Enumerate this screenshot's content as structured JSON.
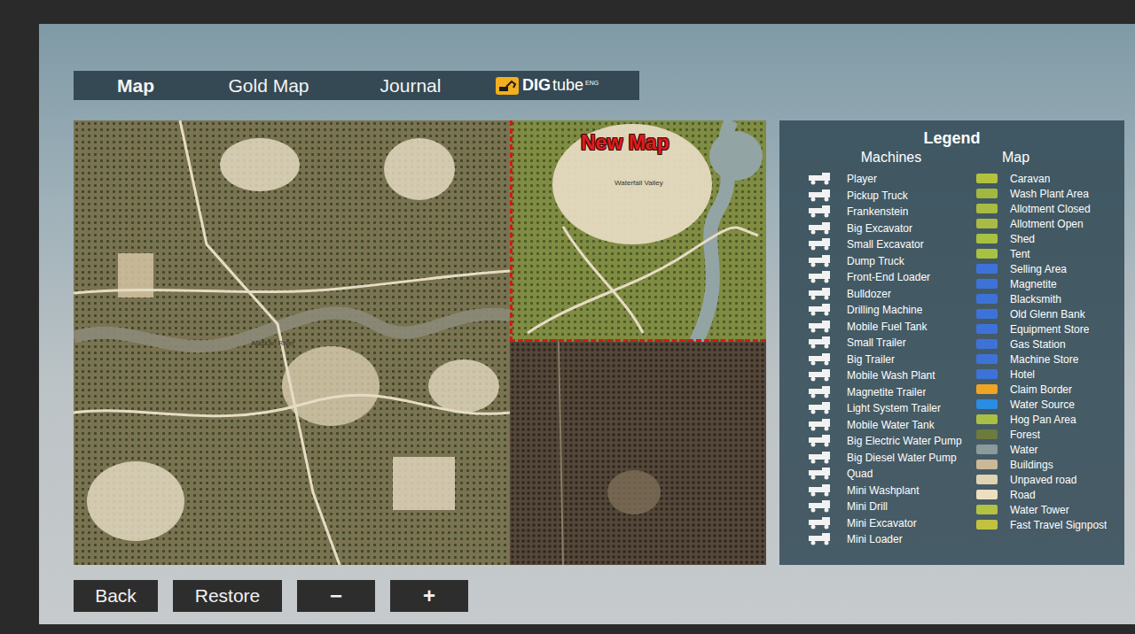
{
  "tabs": [
    {
      "label": "Map",
      "selected": true
    },
    {
      "label": "Gold Map",
      "selected": false
    },
    {
      "label": "Journal",
      "selected": false
    }
  ],
  "brand": {
    "bold": "DIG",
    "light": "tube",
    "superscript": "ENG"
  },
  "map": {
    "new_map_label": "New Map",
    "labels": [
      {
        "text": "Alaskan River",
        "tile": "main"
      },
      {
        "text": "Waterfall Valley",
        "tile": "new"
      }
    ]
  },
  "legend": {
    "title": "Legend",
    "machines": {
      "heading": "Machines",
      "items": [
        "Player",
        "Pickup Truck",
        "Frankenstein",
        "Big Excavator",
        "Small Excavator",
        "Dump Truck",
        "Front-End Loader",
        "Bulldozer",
        "Drilling Machine",
        "Mobile Fuel Tank",
        "Small Trailer",
        "Big Trailer",
        "Mobile Wash Plant",
        "Magnetite Trailer",
        "Light System Trailer",
        "Mobile Water Tank",
        "Big Electric Water Pump",
        "Big Diesel Water Pump",
        "Quad",
        "Mini Washplant",
        "Mini Drill",
        "Mini Excavator",
        "Mini Loader"
      ]
    },
    "map": {
      "heading": "Map",
      "items": [
        {
          "label": "Caravan",
          "color": "#b3c23c"
        },
        {
          "label": "Wash Plant Area",
          "color": "#a3b83e"
        },
        {
          "label": "Allotment Closed",
          "color": "#a9bb42"
        },
        {
          "label": "Allotment Open",
          "color": "#a9bb42"
        },
        {
          "label": "Shed",
          "color": "#a7c141"
        },
        {
          "label": "Tent",
          "color": "#a7c141"
        },
        {
          "label": "Selling Area",
          "color": "#3d73d8"
        },
        {
          "label": "Magnetite",
          "color": "#3d73d8"
        },
        {
          "label": "Blacksmith",
          "color": "#3d73d8"
        },
        {
          "label": "Old Glenn Bank",
          "color": "#3d73d8"
        },
        {
          "label": "Equipment Store",
          "color": "#3d73d8"
        },
        {
          "label": "Gas Station",
          "color": "#3d73d8"
        },
        {
          "label": "Machine Store",
          "color": "#3d73d8"
        },
        {
          "label": "Hotel",
          "color": "#3d73d8"
        },
        {
          "label": "Claim Border",
          "color": "#f0a422"
        },
        {
          "label": "Water Source",
          "color": "#2a8ce2"
        },
        {
          "label": "Hog Pan Area",
          "color": "#a9c045"
        },
        {
          "label": "Forest",
          "color": "#6d7b3c"
        },
        {
          "label": "Water",
          "color": "#8b9a9a"
        },
        {
          "label": "Buildings",
          "color": "#c9b998"
        },
        {
          "label": "Unpaved road",
          "color": "#e2d3b2"
        },
        {
          "label": "Road",
          "color": "#ebdfc2"
        },
        {
          "label": "Water Tower",
          "color": "#b2c341"
        },
        {
          "label": "Fast Travel Signpost",
          "color": "#c3c240"
        }
      ]
    }
  },
  "buttons": [
    "Back",
    "Restore",
    "−",
    "+"
  ]
}
